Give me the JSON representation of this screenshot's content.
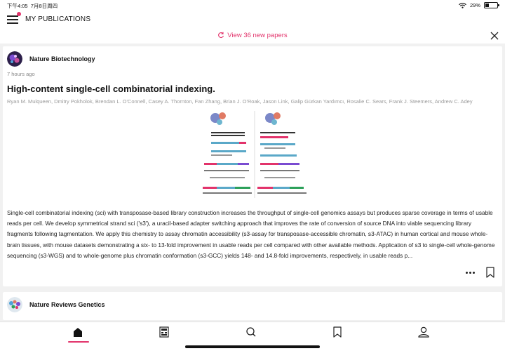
{
  "status_bar": {
    "time": "下午4:05",
    "date": "7月8日周四",
    "battery": "29%",
    "battery_level": 0.29
  },
  "header": {
    "title": "MY PUBLICATIONS"
  },
  "banner": {
    "new_papers_label": "View 36 new papers"
  },
  "feed": [
    {
      "journal": "Nature Biotechnology",
      "time_ago": "7 hours ago",
      "title": "High-content single-cell combinatorial indexing.",
      "authors": "Ryan M. Mulqueen, Dmitry Pokholok, Brendan L. O'Connell, Casey A. Thornton, Fan Zhang, Brian J. O'Roak, Jason Link, Galip Gürkan Yardımcı, Rosalie C. Sears, Frank J. Steemers, Andrew C. Adey",
      "abstract": "Single-cell combinatorial indexing (sci) with transposase-based library construction increases the throughput of single-cell genomics assays but produces sparse coverage in terms of usable reads per cell. We develop symmetrical strand sci ('s3'), a uracil-based adapter switching approach that improves the rate of conversion of source DNA into viable sequencing library fragments following tagmentation. We apply this chemistry to assay chromatin accessibility (s3-assay for transposase-accessible chromatin, s3-ATAC) in human cortical and mouse whole-brain tissues, with mouse datasets demonstrating a six- to 13-fold improvement in usable reads per cell compared with other available methods. Application of s3 to single-cell whole-genome sequencing (s3-WGS) and to whole-genome plus chromatin conformation (s3-GCC) yields 148- and 14.8-fold improvements, respectively, in usable reads p..."
    },
    {
      "journal": "Nature Reviews Genetics"
    }
  ],
  "tabs": [
    {
      "name": "home",
      "icon": "home-icon",
      "active": true
    },
    {
      "name": "journals",
      "icon": "journal-icon",
      "active": false
    },
    {
      "name": "search",
      "icon": "search-icon",
      "active": false
    },
    {
      "name": "saved",
      "icon": "bookmark-icon",
      "active": false
    },
    {
      "name": "profile",
      "icon": "profile-icon",
      "active": false
    }
  ],
  "colors": {
    "accent": "#e2336b",
    "background": "#f1f1f1",
    "card": "#ffffff"
  }
}
